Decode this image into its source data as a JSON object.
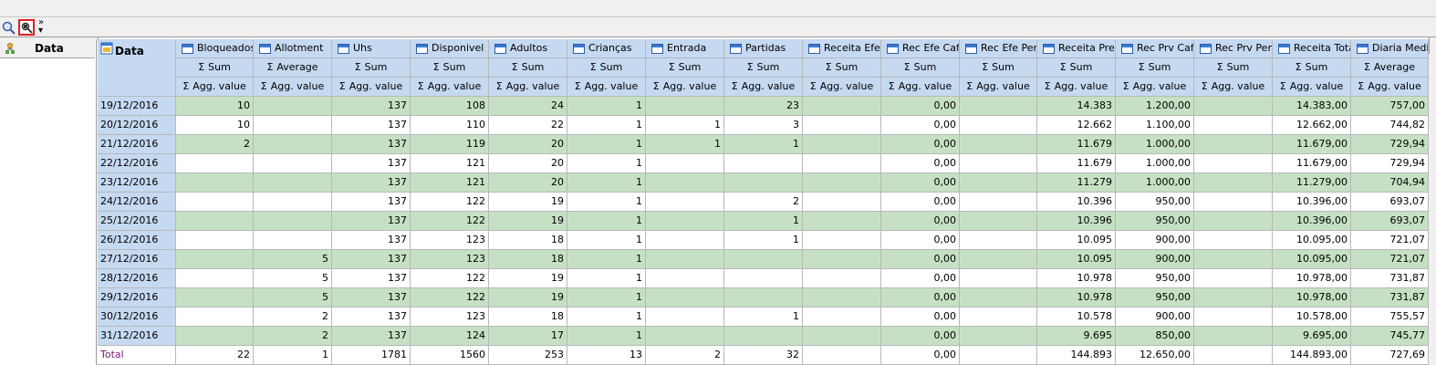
{
  "toolbar": {
    "zoom_icon": "search-zoom-icon",
    "filter_icon": "field-chooser-icon",
    "more_label": "»"
  },
  "left_panel": {
    "header_label": "Data"
  },
  "grid": {
    "row_area_label": "Data",
    "columns": [
      {
        "name": "Bloqueados",
        "agg": "Sum",
        "sub": "Agg. value"
      },
      {
        "name": "Allotment",
        "agg": "Average",
        "sub": "Agg. value"
      },
      {
        "name": "Uhs",
        "agg": "Sum",
        "sub": "Agg. value"
      },
      {
        "name": "Disponivel",
        "agg": "Sum",
        "sub": "Agg. value"
      },
      {
        "name": "Adultos",
        "agg": "Sum",
        "sub": "Agg. value"
      },
      {
        "name": "Crianças",
        "agg": "Sum",
        "sub": "Agg. value"
      },
      {
        "name": "Entrada",
        "agg": "Sum",
        "sub": "Agg. value"
      },
      {
        "name": "Partidas",
        "agg": "Sum",
        "sub": "Agg. value"
      },
      {
        "name": "Receita Efeti",
        "agg": "Sum",
        "sub": "Agg. value"
      },
      {
        "name": "Rec Efe Cafe",
        "agg": "Sum",
        "sub": "Agg. value"
      },
      {
        "name": "Rec Efe Pen",
        "agg": "Sum",
        "sub": "Agg. value"
      },
      {
        "name": "Receita Prev",
        "agg": "Sum",
        "sub": "Agg. value"
      },
      {
        "name": "Rec Prv Cafe",
        "agg": "Sum",
        "sub": "Agg. value"
      },
      {
        "name": "Rec Prv Pen",
        "agg": "Sum",
        "sub": "Agg. value"
      },
      {
        "name": "Receita Tota",
        "agg": "Sum",
        "sub": "Agg. value"
      },
      {
        "name": "Diaria Media",
        "agg": "Average",
        "sub": "Agg. value"
      }
    ],
    "rows": [
      {
        "label": "19/12/2016",
        "values": [
          "10",
          "",
          "137",
          "108",
          "24",
          "1",
          "",
          "23",
          "",
          "0,00",
          "",
          "14.383",
          "1.200,00",
          "",
          "14.383,00",
          "757,00"
        ]
      },
      {
        "label": "20/12/2016",
        "values": [
          "10",
          "",
          "137",
          "110",
          "22",
          "1",
          "1",
          "3",
          "",
          "0,00",
          "",
          "12.662",
          "1.100,00",
          "",
          "12.662,00",
          "744,82"
        ]
      },
      {
        "label": "21/12/2016",
        "values": [
          "2",
          "",
          "137",
          "119",
          "20",
          "1",
          "1",
          "1",
          "",
          "0,00",
          "",
          "11.679",
          "1.000,00",
          "",
          "11.679,00",
          "729,94"
        ]
      },
      {
        "label": "22/12/2016",
        "values": [
          "",
          "",
          "137",
          "121",
          "20",
          "1",
          "",
          "",
          "",
          "0,00",
          "",
          "11.679",
          "1.000,00",
          "",
          "11.679,00",
          "729,94"
        ]
      },
      {
        "label": "23/12/2016",
        "values": [
          "",
          "",
          "137",
          "121",
          "20",
          "1",
          "",
          "",
          "",
          "0,00",
          "",
          "11.279",
          "1.000,00",
          "",
          "11.279,00",
          "704,94"
        ]
      },
      {
        "label": "24/12/2016",
        "values": [
          "",
          "",
          "137",
          "122",
          "19",
          "1",
          "",
          "2",
          "",
          "0,00",
          "",
          "10.396",
          "950,00",
          "",
          "10.396,00",
          "693,07"
        ]
      },
      {
        "label": "25/12/2016",
        "values": [
          "",
          "",
          "137",
          "122",
          "19",
          "1",
          "",
          "1",
          "",
          "0,00",
          "",
          "10.396",
          "950,00",
          "",
          "10.396,00",
          "693,07"
        ]
      },
      {
        "label": "26/12/2016",
        "values": [
          "",
          "",
          "137",
          "123",
          "18",
          "1",
          "",
          "1",
          "",
          "0,00",
          "",
          "10.095",
          "900,00",
          "",
          "10.095,00",
          "721,07"
        ]
      },
      {
        "label": "27/12/2016",
        "values": [
          "",
          "5",
          "137",
          "123",
          "18",
          "1",
          "",
          "",
          "",
          "0,00",
          "",
          "10.095",
          "900,00",
          "",
          "10.095,00",
          "721,07"
        ]
      },
      {
        "label": "28/12/2016",
        "values": [
          "",
          "5",
          "137",
          "122",
          "19",
          "1",
          "",
          "",
          "",
          "0,00",
          "",
          "10.978",
          "950,00",
          "",
          "10.978,00",
          "731,87"
        ]
      },
      {
        "label": "29/12/2016",
        "values": [
          "",
          "5",
          "137",
          "122",
          "19",
          "1",
          "",
          "",
          "",
          "0,00",
          "",
          "10.978",
          "950,00",
          "",
          "10.978,00",
          "731,87"
        ]
      },
      {
        "label": "30/12/2016",
        "values": [
          "",
          "2",
          "137",
          "123",
          "18",
          "1",
          "",
          "1",
          "",
          "0,00",
          "",
          "10.578",
          "900,00",
          "",
          "10.578,00",
          "755,57"
        ]
      },
      {
        "label": "31/12/2016",
        "values": [
          "",
          "2",
          "137",
          "124",
          "17",
          "1",
          "",
          "",
          "",
          "0,00",
          "",
          "9.695",
          "850,00",
          "",
          "9.695,00",
          "745,77"
        ]
      }
    ],
    "total": {
      "label": "Total",
      "values": [
        "22",
        "1",
        "1781",
        "1560",
        "253",
        "13",
        "2",
        "32",
        "",
        "0,00",
        "",
        "144.893",
        "12.650,00",
        "",
        "144.893,00",
        "727,69"
      ]
    }
  }
}
